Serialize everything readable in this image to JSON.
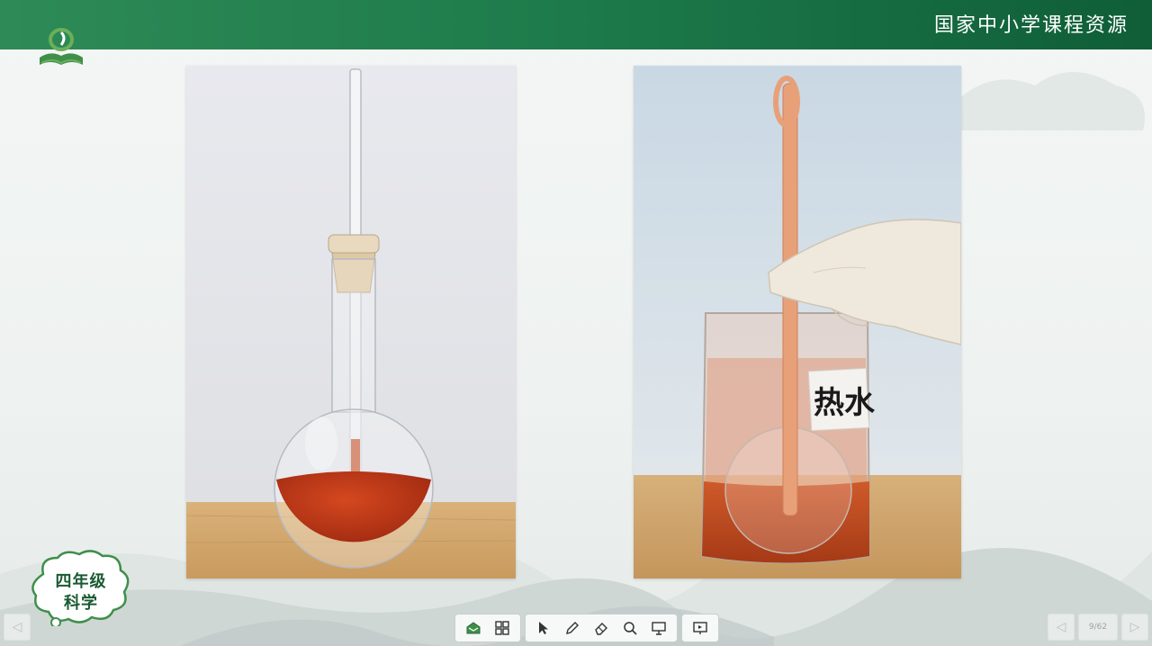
{
  "header": {
    "title": "国家中小学课程资源"
  },
  "badge": {
    "line1": "四年级",
    "line2": "科学"
  },
  "photos": {
    "right_label": "热水"
  },
  "toolbar": {
    "icons": [
      "whiteboard-icon",
      "grid-icon",
      "pointer-icon",
      "pen-icon",
      "eraser-icon",
      "magnifier-icon",
      "spotlight-icon",
      "present-icon"
    ]
  },
  "nav": {
    "page_indicator": "9/62",
    "page_small": "9/62"
  },
  "colors": {
    "header_green": "#1d7a4a",
    "liquid": "#b8341a",
    "badge_text": "#1a5a32"
  }
}
